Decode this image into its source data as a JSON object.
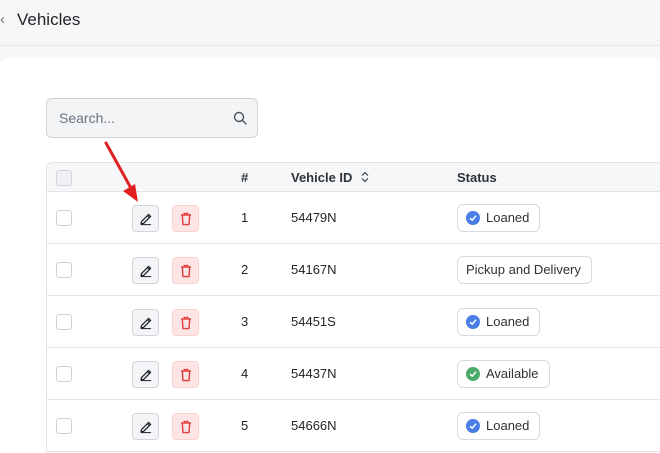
{
  "header": {
    "back_icon": "chevron-left-icon",
    "title": "Vehicles"
  },
  "search": {
    "placeholder": "Search..."
  },
  "table": {
    "columns": {
      "number": "#",
      "vehicle_id": "Vehicle ID",
      "status": "Status"
    },
    "rows": [
      {
        "number": "1",
        "vehicle_id": "54479N",
        "status": "Loaned",
        "status_kind": "loaned"
      },
      {
        "number": "2",
        "vehicle_id": "54167N",
        "status": "Pickup and Delivery",
        "status_kind": "plain"
      },
      {
        "number": "3",
        "vehicle_id": "54451S",
        "status": "Loaned",
        "status_kind": "loaned"
      },
      {
        "number": "4",
        "vehicle_id": "54437N",
        "status": "Available",
        "status_kind": "available"
      },
      {
        "number": "5",
        "vehicle_id": "54666N",
        "status": "Loaned",
        "status_kind": "loaned"
      }
    ]
  },
  "colors": {
    "loaned": "#4a7ee6",
    "available": "#4caa6a",
    "delete": "#e03b3b",
    "annotation_arrow": "#e02020"
  }
}
